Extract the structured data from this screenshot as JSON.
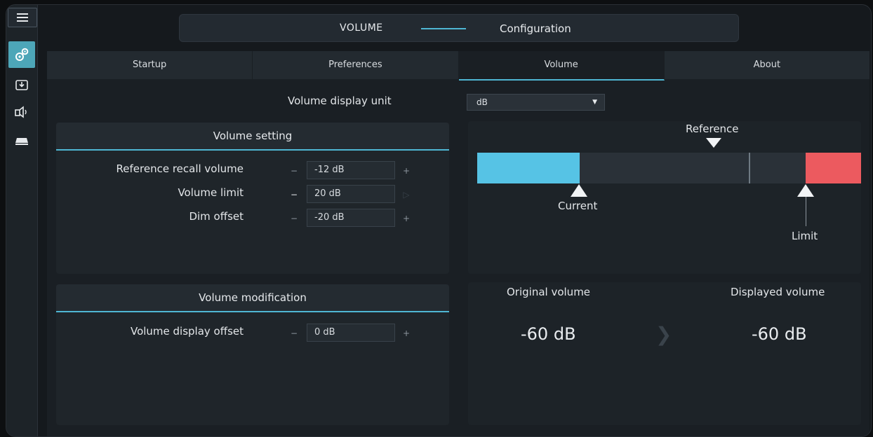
{
  "topbar": {
    "left_label": "VOLUME",
    "right_label": "Configuration",
    "accent": "#4fb7d4"
  },
  "sidebar": {
    "items": [
      {
        "icon": "hamburger-menu-icon"
      },
      {
        "icon": "gears-icon",
        "active": true
      },
      {
        "icon": "import-icon"
      },
      {
        "icon": "speaker-icon"
      },
      {
        "icon": "device-icon"
      }
    ]
  },
  "tabs": [
    {
      "label": "Startup"
    },
    {
      "label": "Preferences"
    },
    {
      "label": "Volume",
      "active": true
    },
    {
      "label": "About"
    }
  ],
  "display_unit": {
    "label": "Volume display unit",
    "value": "dB",
    "arrow": "▼"
  },
  "volume_setting": {
    "title": "Volume setting",
    "rows": [
      {
        "label": "Reference recall volume",
        "value": "-12 dB",
        "minus": "−",
        "plus": "+"
      },
      {
        "label": "Volume limit",
        "value": "20 dB",
        "minus": "−",
        "plus": "▷"
      },
      {
        "label": "Dim offset",
        "value": "-20 dB",
        "minus": "−",
        "plus": "+"
      }
    ]
  },
  "volume_modification": {
    "title": "Volume modification",
    "rows": [
      {
        "label": "Volume display offset",
        "value": "0 dB",
        "minus": "−",
        "plus": "+"
      }
    ]
  },
  "gauge": {
    "reference_label": "Reference",
    "current_label": "Current",
    "limit_label": "Limit",
    "current_level": 0.266,
    "reference_level": 0.707,
    "limit_start_level": 0.855,
    "cyan": "#56c3e5",
    "red": "#ec5a5f"
  },
  "volume_readout": {
    "original_label": "Original volume",
    "original_value": "-60 dB",
    "displayed_label": "Displayed volume",
    "displayed_value": "-60 dB",
    "arrow": "❯"
  }
}
